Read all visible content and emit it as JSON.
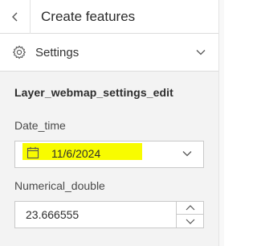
{
  "header": {
    "title": "Create features",
    "back_icon": "chevron-left-icon"
  },
  "settings": {
    "label": "Settings",
    "icon": "gear-icon",
    "toggle_icon": "chevron-down-icon"
  },
  "form": {
    "layer_name": "Layer_webmap_settings_edit",
    "fields": [
      {
        "label": "Date_time",
        "value": "11/6/2024",
        "icon": "calendar-icon",
        "toggle_icon": "chevron-down-icon"
      },
      {
        "label": "Numerical_double",
        "value": "23.666555",
        "stepper_icons": [
          "chevron-up-icon",
          "chevron-down-icon"
        ]
      }
    ]
  },
  "colors": {
    "highlight": "#f8fc00",
    "form_background": "#f3f3f3",
    "border": "#c9c9c9"
  }
}
